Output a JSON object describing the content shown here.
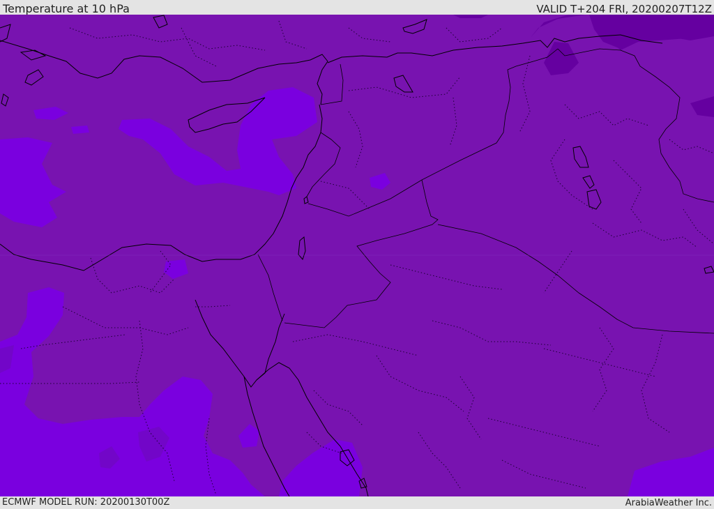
{
  "header": {
    "title": "Temperature at 10 hPa",
    "valid": "VALID T+204 FRI, 20200207T12Z"
  },
  "footer": {
    "model_run": "ECMWF MODEL RUN: 20200130T00Z",
    "credit": "ArabiaWeather Inc."
  },
  "colors": {
    "base_field": "#7813b0",
    "warmer_field": "#7a00df",
    "colder_field": "#6500a0",
    "coastline": "#000000",
    "header_bg": "#e4e4e4"
  }
}
